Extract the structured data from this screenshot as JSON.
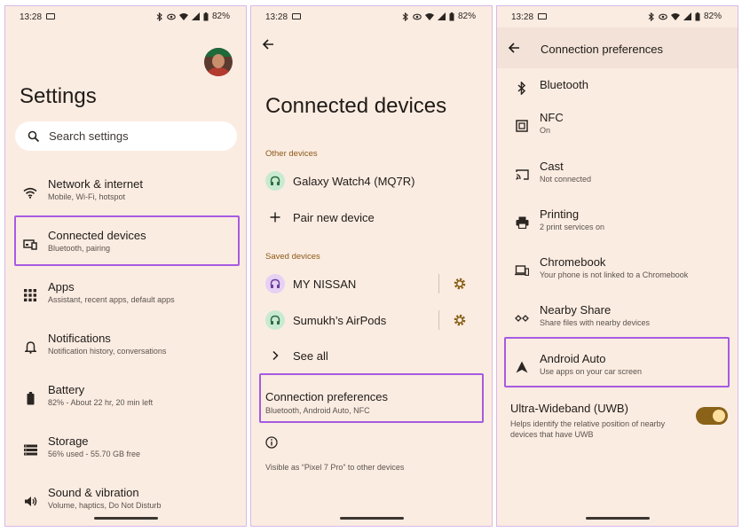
{
  "status": {
    "time": "13:28",
    "battery": "82%"
  },
  "panel1": {
    "title": "Settings",
    "search_placeholder": "Search settings",
    "items": [
      {
        "title": "Network & internet",
        "subtitle": "Mobile, Wi-Fi, hotspot",
        "icon": "wifi-icon"
      },
      {
        "title": "Connected devices",
        "subtitle": "Bluetooth, pairing",
        "icon": "connected-devices-icon"
      },
      {
        "title": "Apps",
        "subtitle": "Assistant, recent apps, default apps",
        "icon": "apps-grid-icon"
      },
      {
        "title": "Notifications",
        "subtitle": "Notification history, conversations",
        "icon": "bell-icon"
      },
      {
        "title": "Battery",
        "subtitle": "82% - About 22 hr, 20 min left",
        "icon": "battery-icon"
      },
      {
        "title": "Storage",
        "subtitle": "56% used - 55.70 GB free",
        "icon": "storage-icon"
      },
      {
        "title": "Sound & vibration",
        "subtitle": "Volume, haptics, Do Not Disturb",
        "icon": "speaker-icon"
      }
    ]
  },
  "panel2": {
    "title": "Connected devices",
    "other_devices_label": "Other devices",
    "galaxy_watch": "Galaxy Watch4 (MQ7R)",
    "pair_new": "Pair new device",
    "saved_devices_label": "Saved devices",
    "my_nissan": "MY NISSAN",
    "airpods": "Sumukh’s AirPods",
    "see_all": "See all",
    "connection_prefs_title": "Connection preferences",
    "connection_prefs_subtitle": "Bluetooth, Android Auto, NFC",
    "visible_as": "Visible as “Pixel 7 Pro” to other devices"
  },
  "panel3": {
    "title": "Connection preferences",
    "items": [
      {
        "title": "Bluetooth",
        "subtitle": "",
        "icon": "bluetooth-icon"
      },
      {
        "title": "NFC",
        "subtitle": "On",
        "icon": "nfc-icon"
      },
      {
        "title": "Cast",
        "subtitle": "Not connected",
        "icon": "cast-icon"
      },
      {
        "title": "Printing",
        "subtitle": "2 print services on",
        "icon": "printer-icon"
      },
      {
        "title": "Chromebook",
        "subtitle": "Your phone is not linked to a Chromebook",
        "icon": "chromebook-icon"
      },
      {
        "title": "Nearby Share",
        "subtitle": "Share files with nearby devices",
        "icon": "nearby-share-icon"
      },
      {
        "title": "Android Auto",
        "subtitle": "Use apps on your car screen",
        "icon": "android-auto-icon"
      }
    ],
    "uwb_title": "Ultra-Wideband (UWB)",
    "uwb_subtitle": "Helps identify the relative position of nearby devices that have UWB",
    "uwb_enabled": true
  },
  "colors": {
    "background": "#fbece2",
    "highlight": "#a65be0",
    "accent": "#8a6218",
    "section_label": "#8a5a16"
  }
}
